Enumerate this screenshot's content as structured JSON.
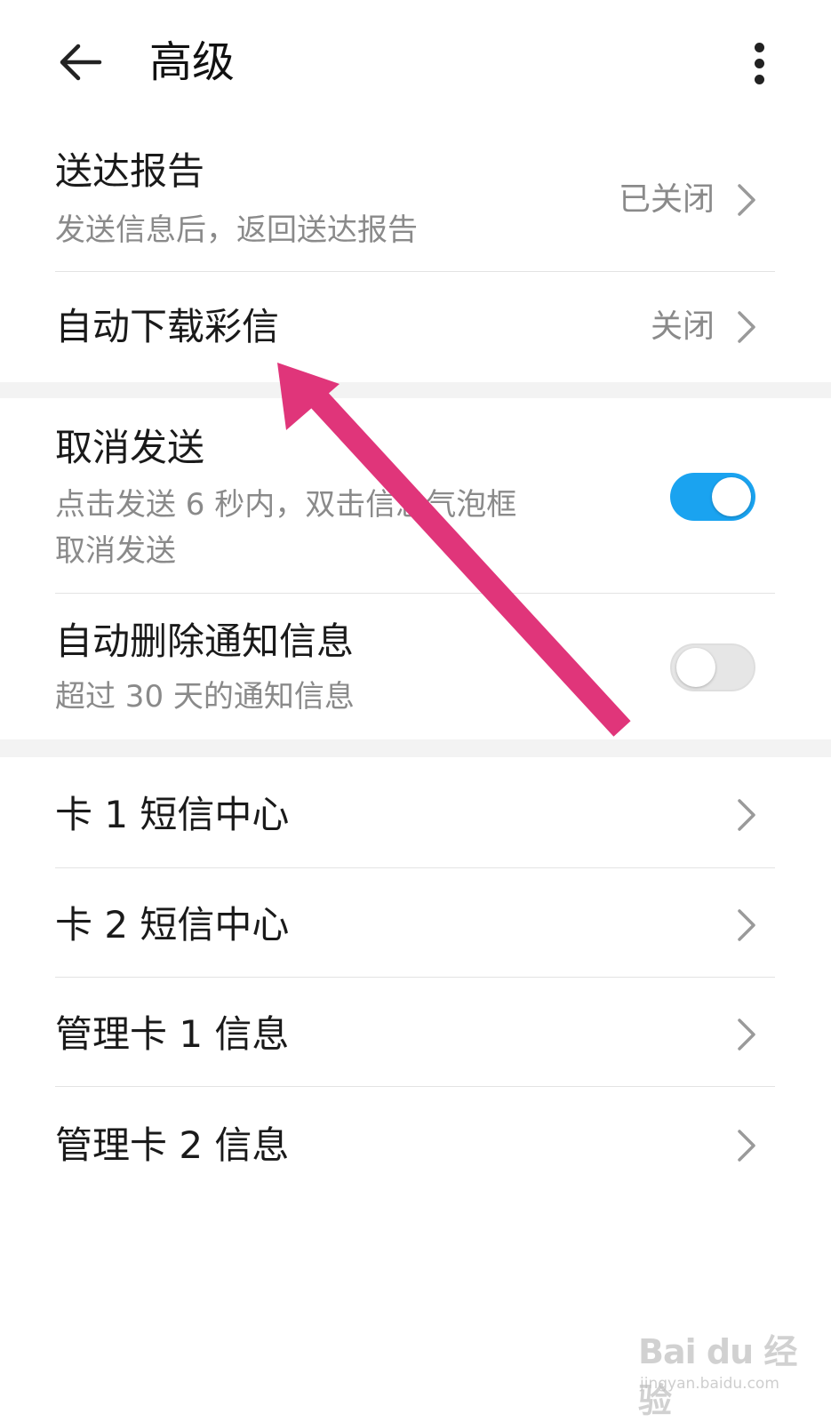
{
  "header": {
    "title": "高级"
  },
  "rows": {
    "delivery_report": {
      "title": "送达报告",
      "subtitle": "发送信息后，返回送达报告",
      "value": "已关闭"
    },
    "auto_download_mms": {
      "title": "自动下载彩信",
      "value": "关闭"
    },
    "cancel_send": {
      "title": "取消发送",
      "subtitle_line1": "点击发送 6 秒内，双击信息气泡框",
      "subtitle_line2": "取消发送",
      "enabled": true
    },
    "auto_delete_notifications": {
      "title": "自动删除通知信息",
      "subtitle": "超过 30 天的通知信息",
      "enabled": false
    },
    "card1_sms_center": {
      "title": "卡 1 短信中心"
    },
    "card2_sms_center": {
      "title": "卡 2 短信中心"
    },
    "manage_card1": {
      "title": "管理卡 1 信息"
    },
    "manage_card2": {
      "title": "管理卡 2 信息"
    }
  },
  "colors": {
    "toggle_on": "#1aa3f0",
    "toggle_off": "#e6e6e6",
    "annotation_arrow": "#e0357a",
    "section_gap": "#f3f3f3"
  },
  "watermark": {
    "brand": "Bai du 经验",
    "url": "jingyan.baidu.com"
  },
  "icons": {
    "back": "arrow-left-icon",
    "more": "more-vertical-icon",
    "chevron": "chevron-right-icon"
  }
}
